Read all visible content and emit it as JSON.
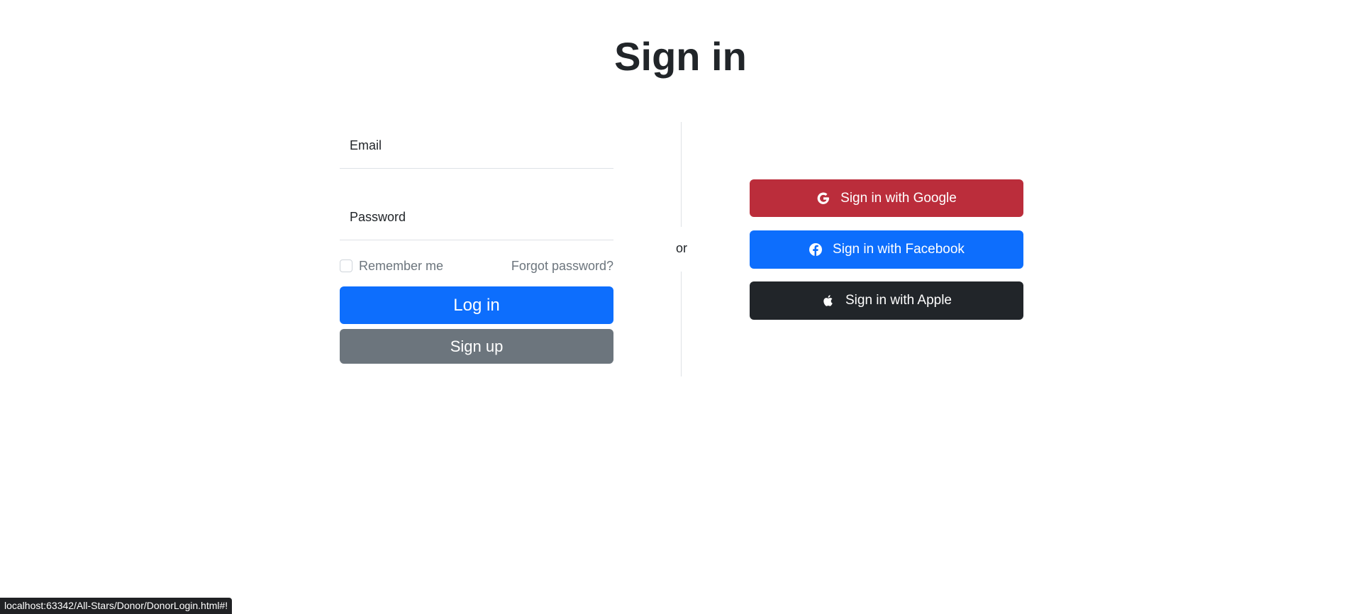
{
  "page": {
    "title": "Sign in"
  },
  "form": {
    "email_label": "Email",
    "password_label": "Password",
    "remember_label": "Remember me",
    "forgot_label": "Forgot password?",
    "login_label": "Log in",
    "signup_label": "Sign up"
  },
  "divider": {
    "label": "or"
  },
  "social": {
    "google_label": "Sign in with Google",
    "facebook_label": "Sign in with Facebook",
    "apple_label": "Sign in with Apple"
  },
  "icons": {
    "google": "google-icon",
    "facebook": "facebook-icon",
    "apple": "apple-icon"
  },
  "colors": {
    "primary": "#0d6efd",
    "secondary": "#6c757d",
    "google": "#bb2d3b",
    "dark": "#212529"
  },
  "status_bar": {
    "url": "localhost:63342/All-Stars/Donor/DonorLogin.html#!"
  }
}
